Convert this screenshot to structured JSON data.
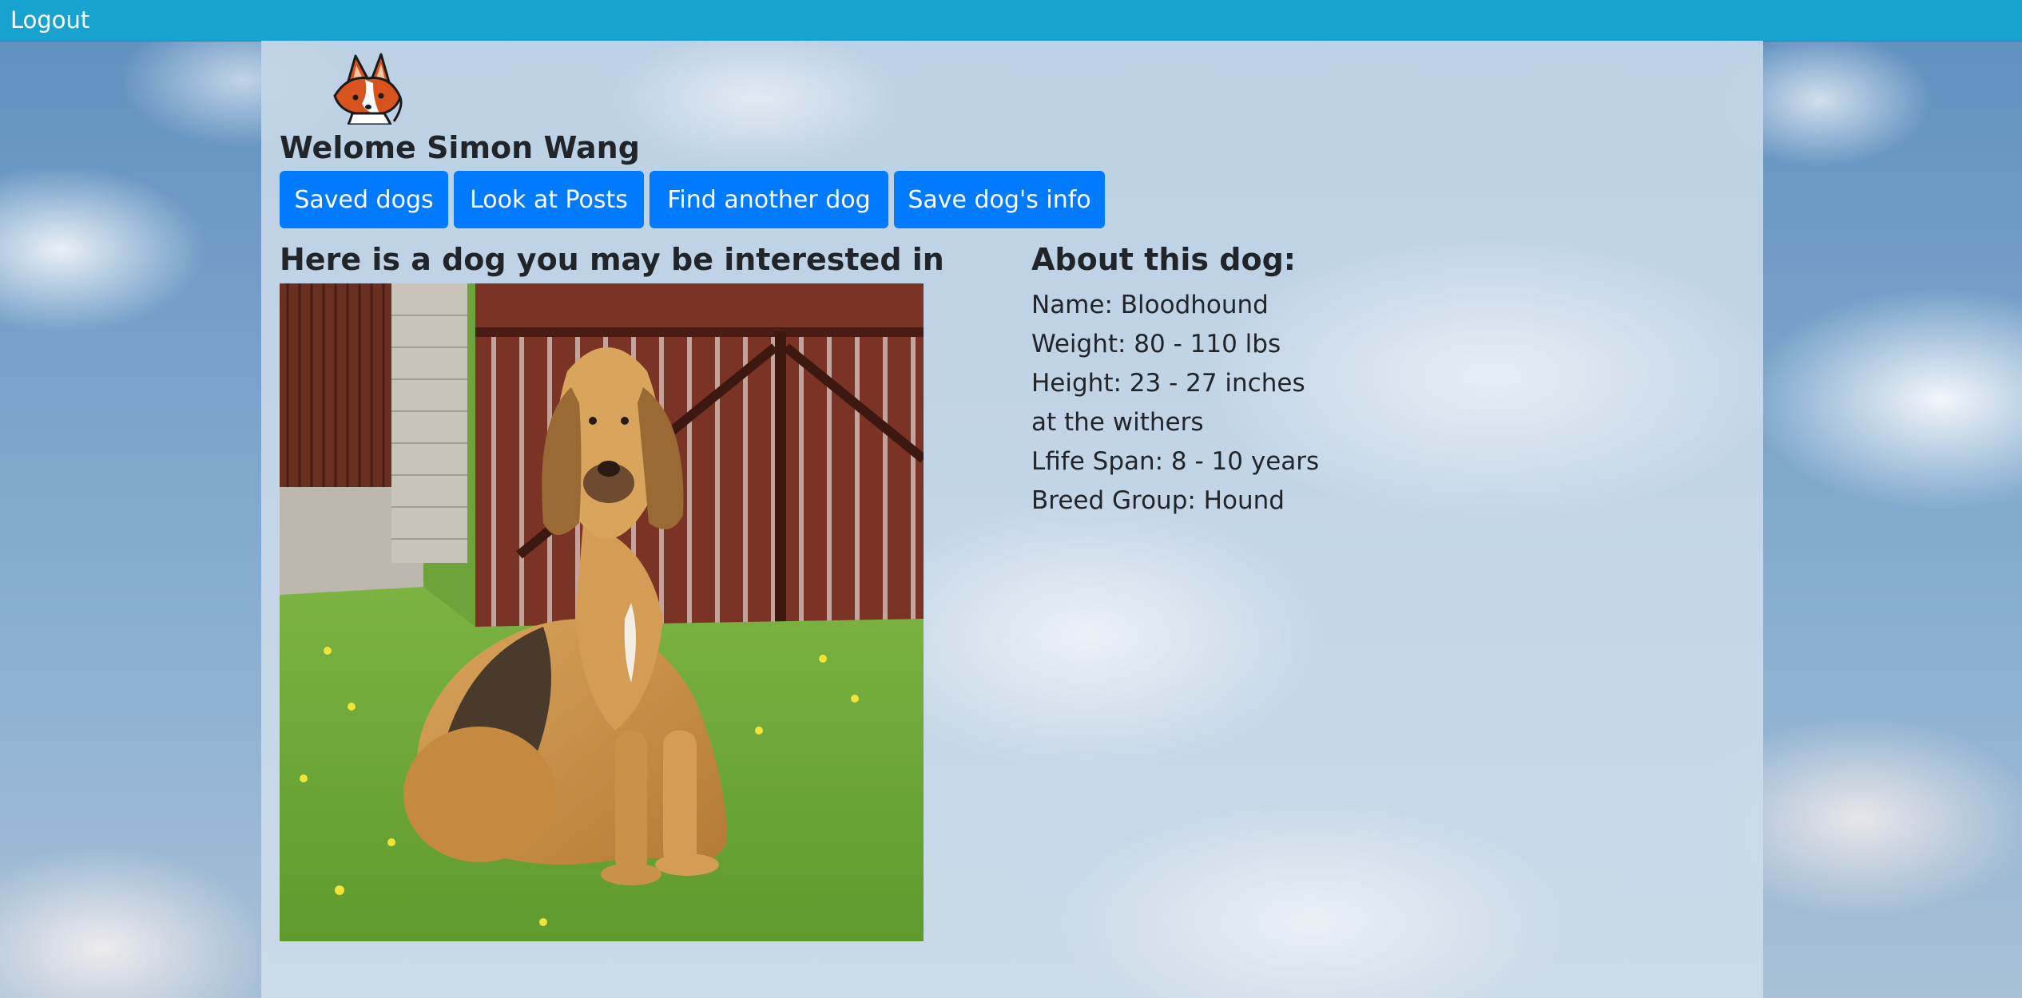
{
  "nav": {
    "logout_label": "Logout"
  },
  "header": {
    "welcome_text": "Welome Simon Wang"
  },
  "buttons": {
    "saved_dogs": "Saved dogs",
    "look_at_posts": "Look at Posts",
    "find_another_dog": "Find another dog",
    "save_dog_info": "Save dog's info"
  },
  "main": {
    "interest_heading": "Here is a dog you may be interested in",
    "image_subject": "bloodhound-photo"
  },
  "about": {
    "heading": "About this dog:",
    "name": "Name: Bloodhound",
    "weight": "Weight: 80 - 110 lbs",
    "height": "Height: 23 - 27 inches at the withers",
    "life_span": "Lfife Span: 8 - 10 years",
    "breed_group": "Breed Group: Hound"
  },
  "colors": {
    "navbar": "#17a2cf",
    "button": "#007bff",
    "text": "#212529"
  }
}
